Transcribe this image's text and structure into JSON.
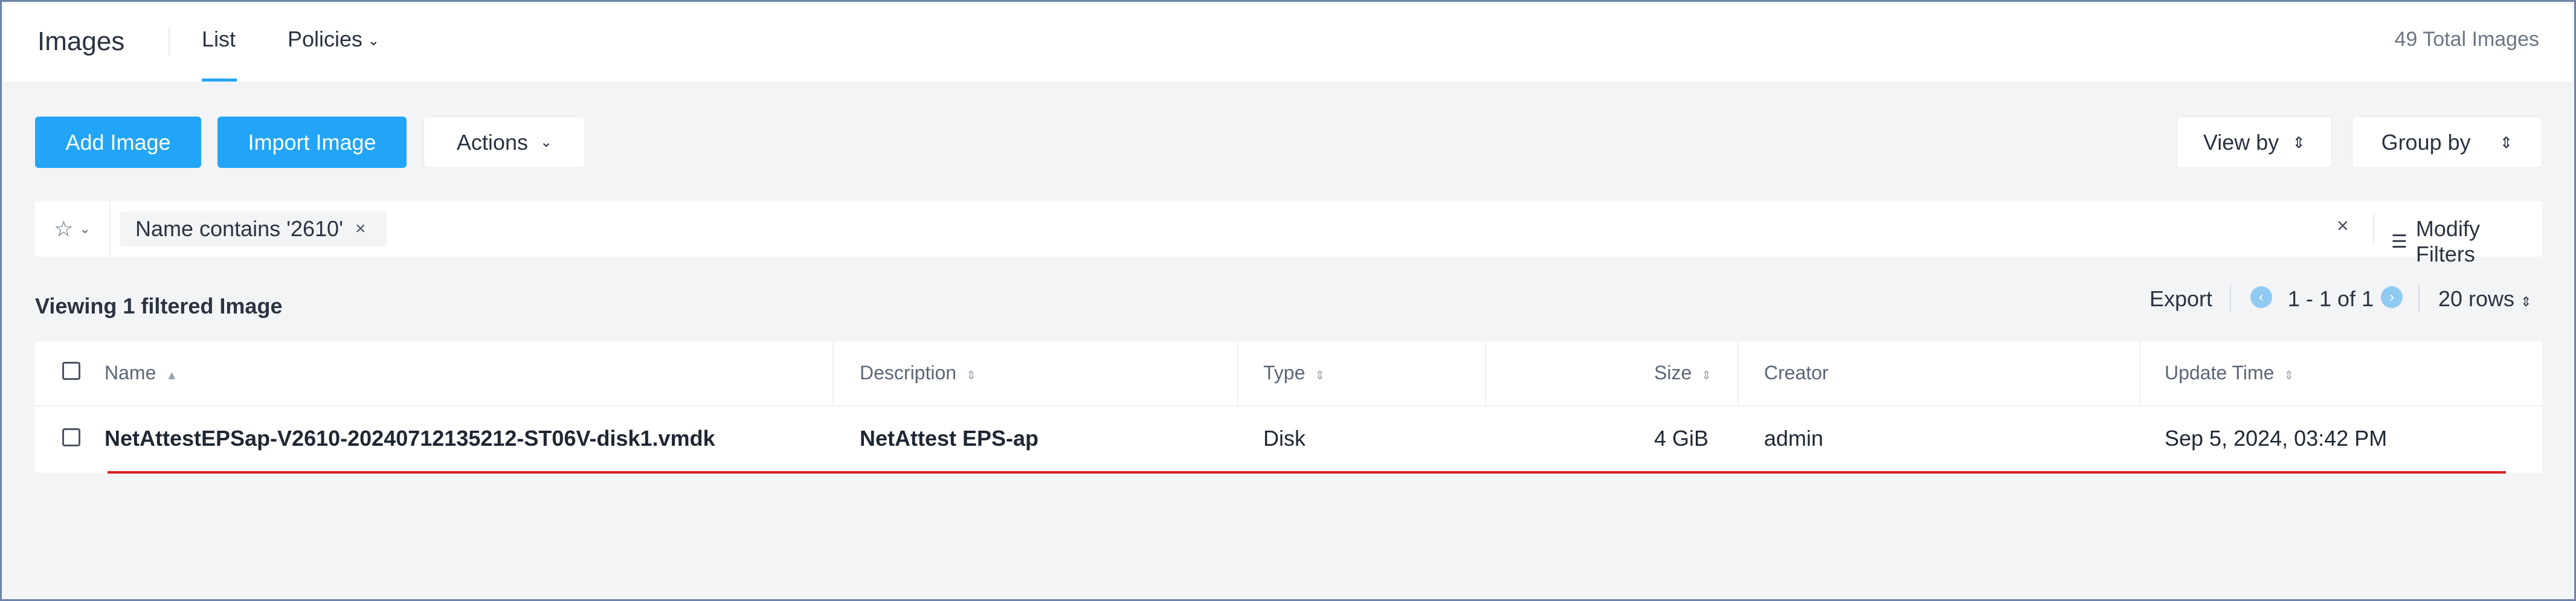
{
  "header": {
    "title": "Images",
    "tabs": [
      {
        "label": "List",
        "active": true
      },
      {
        "label": "Policies",
        "has_dropdown": true
      }
    ],
    "total": "49 Total Images"
  },
  "toolbar": {
    "add_label": "Add Image",
    "import_label": "Import Image",
    "actions_label": "Actions",
    "view_by_label": "View by",
    "group_by_label": "Group by"
  },
  "filter": {
    "chip_label": "Name contains '2610'",
    "chip_remove": "×",
    "clear": "×",
    "modify_label": "Modify Filters"
  },
  "list_status": {
    "viewing": "Viewing 1 filtered Image",
    "export": "Export",
    "range": "1 - 1 of 1",
    "rows": "20 rows"
  },
  "table": {
    "columns": [
      "Name",
      "Description",
      "Type",
      "Size",
      "Creator",
      "Update Time"
    ],
    "rows": [
      {
        "name": "NetAttestEPSap-V2610-20240712135212-ST06V-disk1.vmdk",
        "description": "NetAttest EPS-ap",
        "type": "Disk",
        "size": "4 GiB",
        "creator": "admin",
        "update_time": "Sep 5, 2024, 03:42 PM"
      }
    ]
  },
  "colors": {
    "accent": "#22a5f7",
    "highlight_underline": "#d61f1f",
    "background": "#f2f4f6",
    "frame_border": "#6d84a8"
  },
  "icons": [
    "star-icon",
    "chevron-down-icon",
    "close-icon",
    "filter-icon",
    "chevron-left-icon",
    "chevron-right-icon",
    "sort-icon",
    "updown-icon"
  ]
}
